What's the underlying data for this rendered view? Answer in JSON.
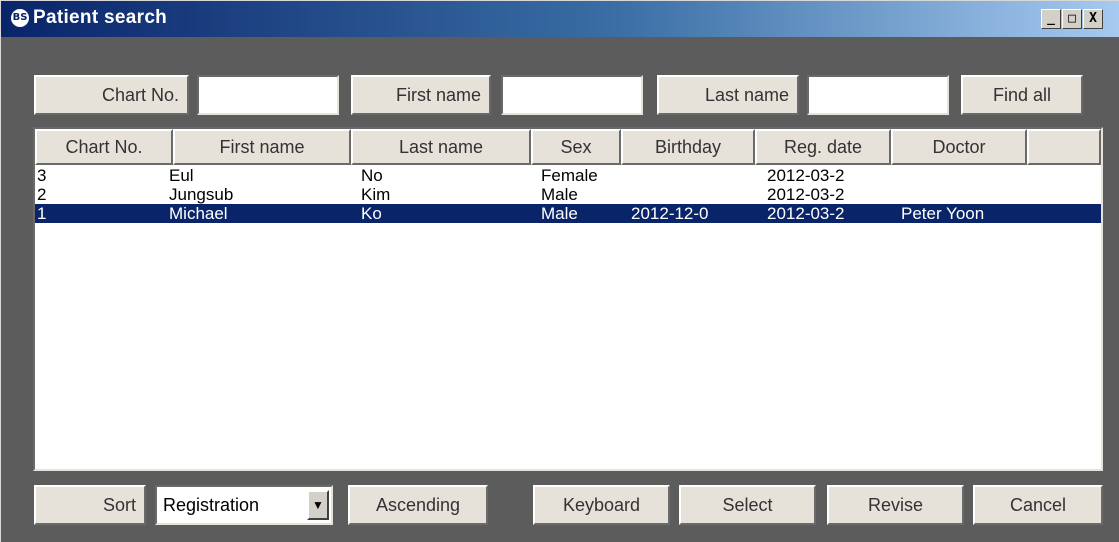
{
  "window": {
    "title": "Patient search",
    "app_icon": "app-logo-icon",
    "controls": {
      "minimize": "_",
      "maximize": "□",
      "close": "X"
    }
  },
  "search": {
    "chart_no_label": "Chart No.",
    "chart_no_value": "",
    "first_name_label": "First name",
    "first_name_value": "",
    "last_name_label": "Last name",
    "last_name_value": "",
    "find_all_label": "Find all"
  },
  "table": {
    "columns": [
      "Chart No.",
      "First name",
      "Last name",
      "Sex",
      "Birthday",
      "Reg. date",
      "Doctor",
      ""
    ],
    "rows": [
      {
        "chart_no": "3",
        "first_name": "Eul",
        "last_name": "No",
        "sex": "Female",
        "birthday": "",
        "reg_date": "2012-03-2",
        "doctor": "",
        "selected": false
      },
      {
        "chart_no": "2",
        "first_name": "Jungsub",
        "last_name": "Kim",
        "sex": "Male",
        "birthday": "",
        "reg_date": "2012-03-2",
        "doctor": "",
        "selected": false
      },
      {
        "chart_no": "1",
        "first_name": "Michael",
        "last_name": "Ko",
        "sex": "Male",
        "birthday": "2012-12-0",
        "reg_date": "2012-03-2",
        "doctor": "Peter Yoon",
        "selected": true
      }
    ]
  },
  "footer": {
    "sort_label": "Sort",
    "sort_by_value": "Registration",
    "order_label": "Ascending",
    "keyboard_label": "Keyboard",
    "select_label": "Select",
    "revise_label": "Revise",
    "cancel_label": "Cancel"
  },
  "colors": {
    "titlebar_start": "#0a246a",
    "titlebar_end": "#a6caf0",
    "window_bg": "#5c5c5c",
    "button_face": "#e6e1d9",
    "selection": "#0a246a"
  }
}
